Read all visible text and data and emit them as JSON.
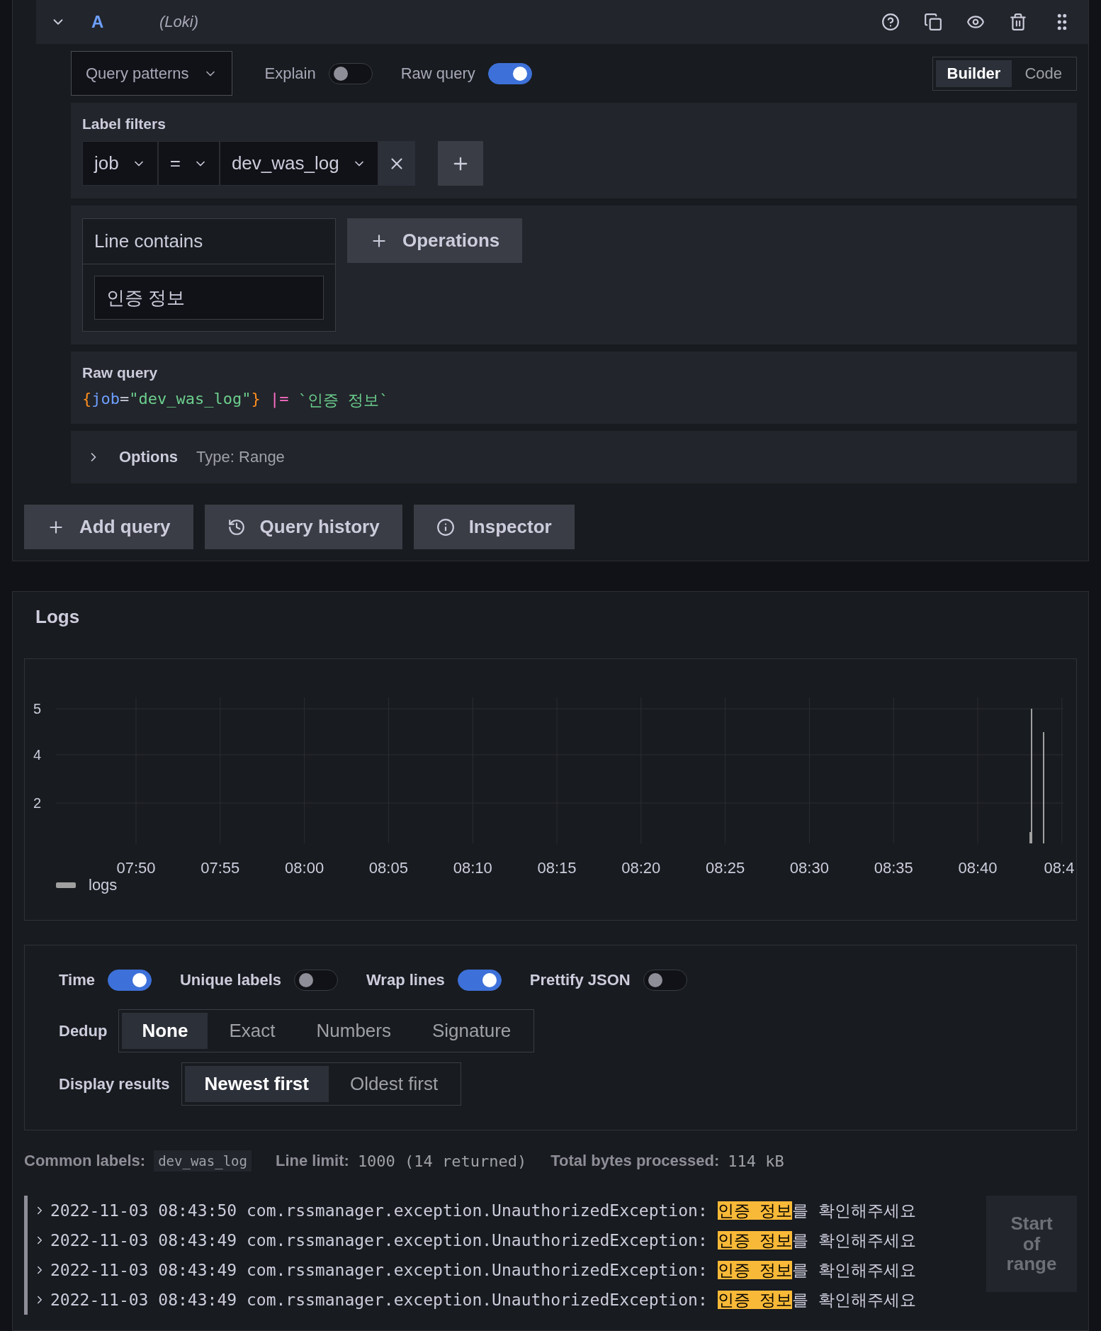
{
  "query": {
    "ref": "A",
    "datasource": "(Loki)",
    "patterns_button": "Query patterns",
    "toggles": [
      {
        "label": "Explain",
        "on": false
      },
      {
        "label": "Raw query",
        "on": true
      }
    ],
    "mode_tabs": [
      {
        "label": "Builder",
        "selected": true
      },
      {
        "label": "Code",
        "selected": false
      }
    ],
    "label_filters": {
      "title": "Label filters",
      "label": "job",
      "operator": "=",
      "value": "dev_was_log"
    },
    "line_contains": {
      "title": "Line contains",
      "value": "인증 정보"
    },
    "operations_button": "Operations",
    "raw_query": {
      "title": "Raw query",
      "tokens": [
        {
          "kind": "brace",
          "text": "{"
        },
        {
          "kind": "label",
          "text": "job"
        },
        {
          "kind": "op",
          "text": "="
        },
        {
          "kind": "string",
          "text": "\"dev_was_log\""
        },
        {
          "kind": "brace",
          "text": "}"
        },
        {
          "kind": "pipe",
          "text": "|="
        },
        {
          "kind": "string",
          "text": "`인증 정보`"
        }
      ]
    },
    "options": {
      "title": "Options",
      "summary": "Type: Range"
    }
  },
  "actions": [
    {
      "kind": "add",
      "label": "Add query"
    },
    {
      "kind": "history",
      "label": "Query history"
    },
    {
      "kind": "info",
      "label": "Inspector"
    }
  ],
  "logs": {
    "title": "Logs",
    "graph": {
      "y_labels": [
        "5",
        "4",
        "2"
      ],
      "x_labels": [
        "07:50",
        "07:55",
        "08:00",
        "08:05",
        "08:10",
        "08:15",
        "08:20",
        "08:25",
        "08:30",
        "08:35",
        "08:40",
        "08:4"
      ],
      "legend": "logs"
    },
    "toggles": [
      {
        "label": "Time",
        "on": true
      },
      {
        "label": "Unique labels",
        "on": false
      },
      {
        "label": "Wrap lines",
        "on": true
      },
      {
        "label": "Prettify JSON",
        "on": false
      }
    ],
    "dedup": {
      "label": "Dedup",
      "options": [
        {
          "label": "None",
          "selected": true
        },
        {
          "label": "Exact",
          "selected": false
        },
        {
          "label": "Numbers",
          "selected": false
        },
        {
          "label": "Signature",
          "selected": false
        }
      ]
    },
    "display": {
      "label": "Display results",
      "options": [
        {
          "label": "Newest first",
          "selected": true
        },
        {
          "label": "Oldest first",
          "selected": false
        }
      ]
    },
    "meta": [
      {
        "label": "Common labels:",
        "value": "dev_was_log",
        "kind": "tag"
      },
      {
        "label": "Line limit:",
        "value": "1000 (14 returned)",
        "kind": "text"
      },
      {
        "label": "Total bytes processed:",
        "value": "114 kB",
        "kind": "text"
      }
    ],
    "rows": [
      {
        "time": "2022-11-03 08:43:50",
        "message": "com.rssmanager.exception.UnauthorizedException:",
        "match": "인증 정보",
        "rest": "를 확인해주세요"
      },
      {
        "time": "2022-11-03 08:43:49",
        "message": "com.rssmanager.exception.UnauthorizedException:",
        "match": "인증 정보",
        "rest": "를 확인해주세요"
      },
      {
        "time": "2022-11-03 08:43:49",
        "message": "com.rssmanager.exception.UnauthorizedException:",
        "match": "인증 정보",
        "rest": "를 확인해주세요"
      },
      {
        "time": "2022-11-03 08:43:49",
        "message": "com.rssmanager.exception.UnauthorizedException:",
        "match": "인증 정보",
        "rest": "를 확인해주세요"
      }
    ],
    "range_button": "Start of range"
  }
}
